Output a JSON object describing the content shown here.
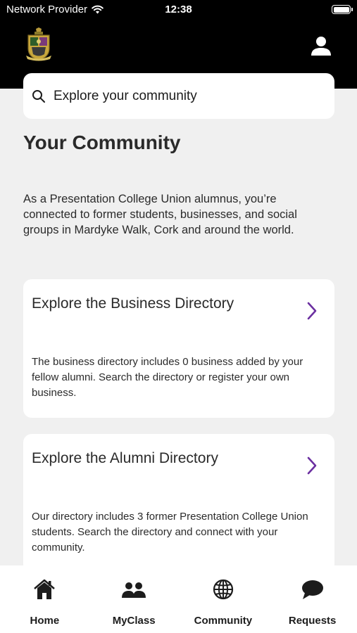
{
  "status_bar": {
    "carrier": "Network Provider",
    "time": "12:38"
  },
  "search": {
    "placeholder": "Explore your community"
  },
  "page": {
    "title": "Your Community",
    "intro": "As a Presentation College Union alumnus, you’re connected to former students, businesses, and social groups in Mardyke Walk, Cork and around the world."
  },
  "cards": [
    {
      "title": "Explore the Business Directory",
      "description": "The business directory includes 0 business added by your fellow alumni. Search the directory or register your own business."
    },
    {
      "title": "Explore the Alumni Directory",
      "description": "Our directory includes 3 former Presentation College Union students. Search the directory and connect with your community."
    }
  ],
  "tabs": [
    {
      "label": "Home",
      "icon": "home-icon"
    },
    {
      "label": "MyClass",
      "icon": "people-icon"
    },
    {
      "label": "Community",
      "icon": "globe-icon"
    },
    {
      "label": "Requests",
      "icon": "chat-bubble-icon"
    }
  ],
  "colors": {
    "header": "#000000",
    "background": "#f0f0f0",
    "accent": "#6b2fa0"
  }
}
